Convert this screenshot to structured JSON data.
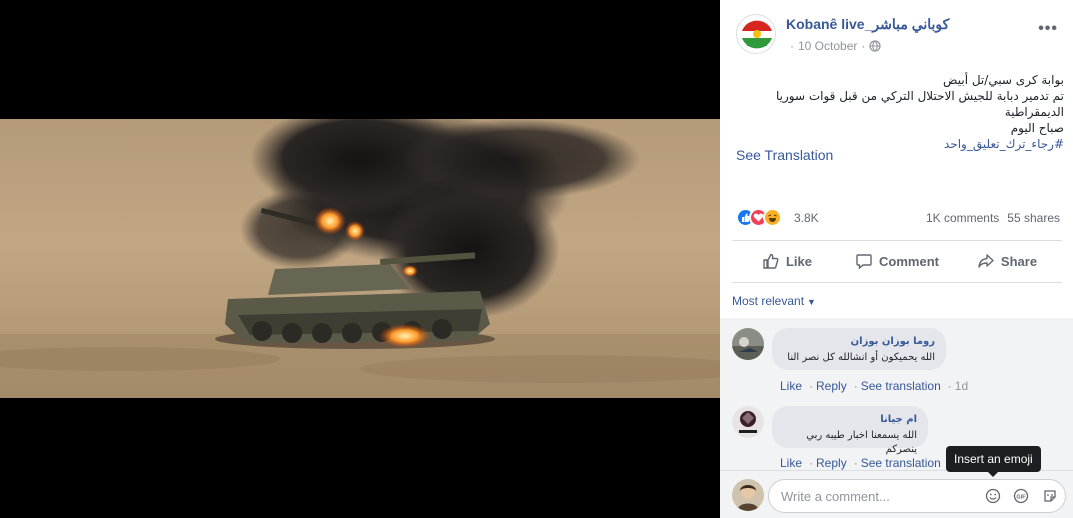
{
  "post": {
    "page_name": "Kobanê live_كوباني مباشر",
    "date": "10 October",
    "text_lines": [
      "بوابة كرى سبي/تل أبيض",
      "تم تدمير دبابة للجيش الاحتلال التركي من قبل قوات سوريا الديمقراطية",
      "صباح اليوم"
    ],
    "hashtag": "#رجاء_ترك_تعليق_واحد",
    "see_translation": "See Translation"
  },
  "reactions": {
    "count": "3.8K",
    "types": [
      "like",
      "love",
      "haha"
    ],
    "comments": "1K comments",
    "shares": "55 shares"
  },
  "actions": {
    "like": "Like",
    "comment": "Comment",
    "share": "Share"
  },
  "comments_section": {
    "filter": "Most relevant",
    "items": [
      {
        "author": "روما بوزان بوزان",
        "text": "الله يحميكون أو انشالله كل نصر النا",
        "like": "Like",
        "reply": "Reply",
        "see_translation": "See translation",
        "time": "1d"
      },
      {
        "author": "ام جيانا",
        "text": "الله يسمعنا اخبار طيبه ربي ينصركم",
        "like": "Like",
        "reply": "Reply",
        "see_translation": "See translation",
        "time": ""
      }
    ]
  },
  "composer": {
    "placeholder": "Write a comment...",
    "tooltip": "Insert an emoji"
  },
  "colors": {
    "link": "#385898",
    "muted": "#90949c",
    "panel_bg": "#ffffff",
    "comment_area_bg": "#f2f3f5"
  }
}
